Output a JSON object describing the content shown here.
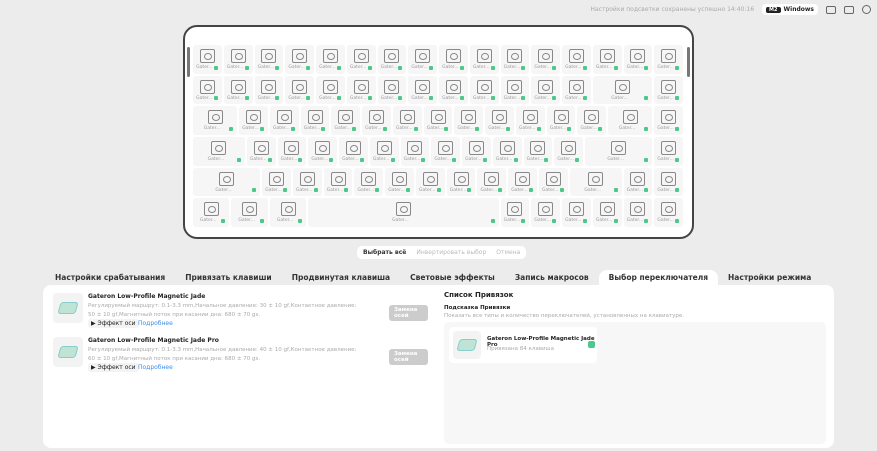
{
  "topbar": {
    "status": "Настройки подсветки сохранены успешно 14:40:16",
    "os_badge": "M2",
    "os": "Windows"
  },
  "keyboard": {
    "key_label": "Gater...",
    "rows": [
      16,
      15,
      15,
      14,
      14,
      10
    ]
  },
  "selection": {
    "select_all": "Выбрать всё",
    "invert": "Инвертировать выбор",
    "cancel": "Отмена"
  },
  "tabs": [
    "Настройки срабатывания",
    "Привязать клавиши",
    "Продвинутая клавиша",
    "Световые эффекты",
    "Запись макросов",
    "Выбор переключателя",
    "Настройки режима"
  ],
  "active_tab": 5,
  "switches": [
    {
      "name": "Gateron Low-Profile Magnetic Jade",
      "desc": "Регулируемый маршрут: 0.1-3.3 mm,Начальное давление: 30 ± 10 gf,Контактное давление: 50 ± 10 gf,Магнитный поток при касании дна: 680 ± 70 gs.",
      "effect": "Эффект оси",
      "more": "Подробнее",
      "replace": "Замена осей"
    },
    {
      "name": "Gateron Low-Profile Magnetic Jade Pro",
      "desc": "Регулируемый маршрут: 0.1-3.3 mm,Начальное давление: 40 ± 10 gf,Контактное давление: 60 ± 10 gf,Магнитный поток при касании дна: 680 ± 70 gs.",
      "effect": "Эффект оси",
      "more": "Подробнее",
      "replace": "Замена осей"
    }
  ],
  "bindings": {
    "title": "Список Привязок",
    "subtitle": "Подсказка Привязки",
    "desc": "Показать все типы и количество переключателей, установленных на клавиатуре.",
    "item": {
      "name": "Gateron Low-Profile Magnetic Jade Pro",
      "count": "Привязана 84 клавиша"
    }
  }
}
